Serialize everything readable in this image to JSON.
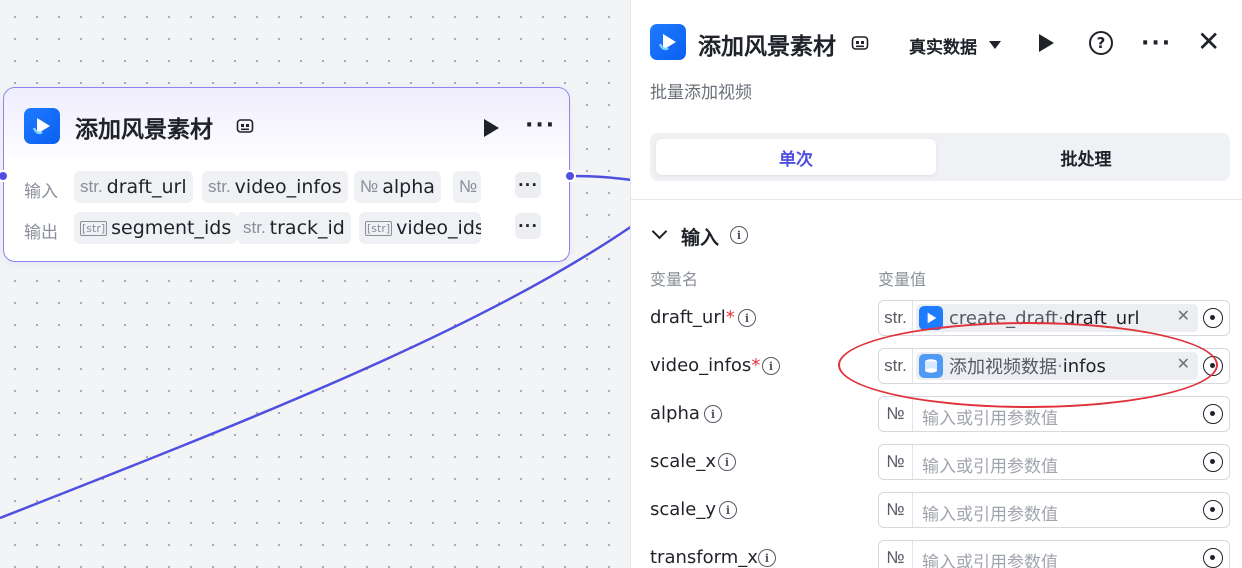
{
  "node": {
    "title": "添加风景素材",
    "inputs_label": "输入",
    "outputs_label": "输出",
    "inputs": [
      {
        "type": "str.",
        "name": "draft_url"
      },
      {
        "type": "str.",
        "name": "video_infos"
      },
      {
        "type": "№",
        "name": "alpha"
      },
      {
        "type": "№",
        "name": ""
      }
    ],
    "outputs": [
      {
        "type": "[str]",
        "name": "segment_ids"
      },
      {
        "type": "str.",
        "name": "track_id"
      },
      {
        "type": "[str]",
        "name": "video_ids"
      }
    ],
    "more": "···"
  },
  "panel": {
    "title": "添加风景素材",
    "data_mode": "真实数据",
    "subtitle": "批量添加视频",
    "tabs": [
      "单次",
      "批处理"
    ],
    "section_title": "输入",
    "col_name": "变量名",
    "col_value": "变量值",
    "close": "✕",
    "help": "?",
    "more": "···",
    "params": [
      {
        "name": "draft_url",
        "required": "*",
        "type": "str.",
        "ref_node": "create_draft",
        "ref_sep": " · ",
        "ref_field": "draft_url",
        "placeholder": ""
      },
      {
        "name": "video_infos",
        "required": "*",
        "type": "str.",
        "ref_node": "添加视频数据",
        "ref_sep": " · ",
        "ref_field": "infos",
        "placeholder": ""
      },
      {
        "name": "alpha",
        "required": "",
        "type": "№",
        "placeholder": "输入或引用参数值"
      },
      {
        "name": "scale_x",
        "required": "",
        "type": "№",
        "placeholder": "输入或引用参数值"
      },
      {
        "name": "scale_y",
        "required": "",
        "type": "№",
        "placeholder": "输入或引用参数值"
      },
      {
        "name": "transform_x",
        "required": "",
        "type": "№",
        "placeholder": "输入或引用参数值"
      }
    ]
  },
  "colors": {
    "accent": "#4f4fe0",
    "edge": "#4f4fe0",
    "highlight_oval": "#e0323a",
    "brand_icon": "#1f7bff"
  }
}
